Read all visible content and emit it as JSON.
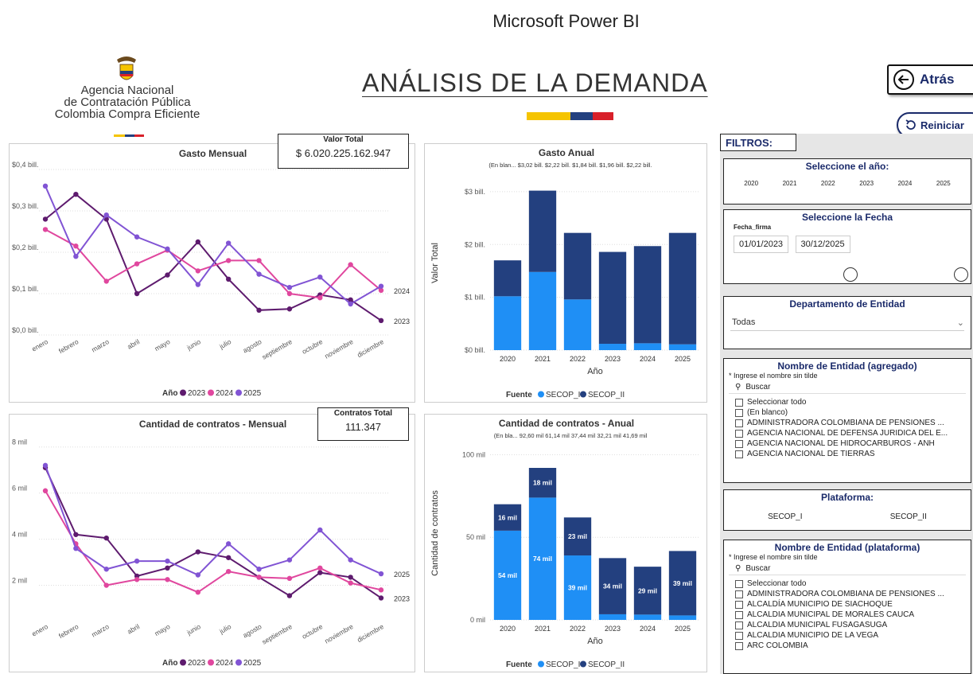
{
  "header": {
    "app_title": "Microsoft Power BI",
    "agency_line1": "Agencia Nacional",
    "agency_line2": "de Contratación Pública",
    "agency_line3": "Colombia Compra Eficiente",
    "page_title": "ANÁLISIS DE LA DEMANDA",
    "back_label": "Atrás",
    "reset_label": "Reiniciar",
    "colors": {
      "yellow": "#f5c400",
      "blue": "#23407f",
      "red": "#d8202a"
    }
  },
  "kpis": {
    "valor_label": "Valor Total",
    "valor_value": "$ 6.020.225.162.947",
    "contratos_label": "Contratos Total",
    "contratos_value": "111.347"
  },
  "chart_data": [
    {
      "id": "gasto_mensual",
      "type": "line",
      "title": "Gasto Mensual",
      "categories": [
        "enero",
        "febrero",
        "marzo",
        "abril",
        "mayo",
        "junio",
        "julio",
        "agosto",
        "septiembre",
        "octubre",
        "noviembre",
        "diciembre"
      ],
      "y_tick_labels": [
        "$0,0 bill.",
        "$0,1 bill.",
        "$0,2 bill.",
        "$0,3 bill.",
        "$0,4 bill."
      ],
      "ylim": [
        0,
        0.4
      ],
      "legend_title": "Año",
      "series": [
        {
          "name": "2023",
          "color": "#5e1b6e",
          "values": [
            0.28,
            0.34,
            0.28,
            0.1,
            0.145,
            0.225,
            0.135,
            0.06,
            0.063,
            0.097,
            0.085,
            0.035
          ]
        },
        {
          "name": "2024",
          "color": "#e0479e",
          "values": [
            0.255,
            0.215,
            0.13,
            0.172,
            0.205,
            0.155,
            0.18,
            0.18,
            0.1,
            0.09,
            0.17,
            0.108
          ]
        },
        {
          "name": "2025",
          "color": "#8154d4",
          "values": [
            0.36,
            0.19,
            0.29,
            0.237,
            0.208,
            0.122,
            0.222,
            0.147,
            0.115,
            0.14,
            0.075,
            0.118
          ]
        }
      ],
      "end_labels": [
        "2024",
        "2023"
      ]
    },
    {
      "id": "gasto_anual",
      "type": "bar",
      "stacked": true,
      "title": "Gasto Anual",
      "xlabel": "Año",
      "ylabel": "Valor Total",
      "categories": [
        "2020",
        "2021",
        "2022",
        "2023",
        "2024",
        "2025"
      ],
      "y_tick_labels": [
        "$0 bill.",
        "$1 bill.",
        "$2 bill.",
        "$3 bill."
      ],
      "ylim": [
        0,
        3.3
      ],
      "totals_label": "(En blan... $3,02 bill. $2,22 bill.  $1,84 bill. $1,96 bill. $2,22 bill.",
      "legend_title": "Fuente",
      "series": [
        {
          "name": "SECOP_I",
          "color": "#1f8ff5",
          "values": [
            1.02,
            1.48,
            0.96,
            0.12,
            0.13,
            0.11
          ]
        },
        {
          "name": "SECOP_II",
          "color": "#23407f",
          "values": [
            0.68,
            1.54,
            1.26,
            1.74,
            1.84,
            2.11
          ]
        }
      ]
    },
    {
      "id": "contratos_mensual",
      "type": "line",
      "title": "Cantidad de contratos - Mensual",
      "categories": [
        "enero",
        "febrero",
        "marzo",
        "abril",
        "mayo",
        "junio",
        "julio",
        "agosto",
        "septiembre",
        "octubre",
        "noviembre",
        "diciembre"
      ],
      "y_tick_labels": [
        "2 mil",
        "4 mil",
        "6 mil",
        "8 mil"
      ],
      "ylim": [
        0.5,
        8.3
      ],
      "legend_title": "Año",
      "series": [
        {
          "name": "2023",
          "color": "#5e1b6e",
          "values": [
            7.1,
            4.2,
            4.05,
            2.4,
            2.75,
            3.45,
            3.2,
            2.35,
            1.55,
            2.55,
            2.35,
            1.45
          ]
        },
        {
          "name": "2024",
          "color": "#e0479e",
          "values": [
            6.1,
            3.8,
            2.0,
            2.25,
            2.25,
            1.7,
            2.6,
            2.35,
            2.3,
            2.75,
            2.1,
            1.8
          ]
        },
        {
          "name": "2025",
          "color": "#8154d4",
          "values": [
            7.2,
            3.6,
            2.7,
            3.05,
            3.05,
            2.45,
            3.8,
            2.7,
            3.1,
            4.4,
            3.1,
            2.5
          ]
        }
      ],
      "end_labels": [
        "2025",
        "2023"
      ]
    },
    {
      "id": "contratos_anual",
      "type": "bar",
      "stacked": true,
      "title": "Cantidad de contratos - Anual",
      "xlabel": "Año",
      "ylabel": "Cantidad de contratos",
      "categories": [
        "2020",
        "2021",
        "2022",
        "2023",
        "2024",
        "2025"
      ],
      "y_tick_labels": [
        "0 mil",
        "50 mil",
        "100 mil"
      ],
      "ylim": [
        0,
        105
      ],
      "totals_label": "(En bla... 92,60 mil  61,14 mil  37,44 mil  32,21 mil    41,69 mil",
      "legend_title": "Fuente",
      "series": [
        {
          "name": "SECOP_I",
          "color": "#1f8ff5",
          "values": [
            54,
            74,
            39,
            3.4,
            3.2,
            2.7
          ],
          "labels": [
            "54 mil",
            "74 mil",
            "39 mil",
            "",
            "",
            ""
          ]
        },
        {
          "name": "SECOP_II",
          "color": "#23407f",
          "values": [
            16,
            18,
            23,
            34,
            29,
            39
          ],
          "labels": [
            "16 mil",
            "18 mil",
            "23 mil",
            "34 mil",
            "29 mil",
            "39 mil"
          ]
        }
      ]
    }
  ],
  "filters": {
    "label": "FILTROS:",
    "year": {
      "title": "Seleccione el año:",
      "options": [
        "2020",
        "2021",
        "2022",
        "2023",
        "2024",
        "2025"
      ]
    },
    "date": {
      "title": "Seleccione la Fecha",
      "field": "Fecha_firma",
      "start": "01/01/2023",
      "end": "30/12/2025"
    },
    "departamento": {
      "title": "Departamento de Entidad",
      "value": "Todas"
    },
    "entidad_agregado": {
      "title": "Nombre de Entidad (agregado)",
      "hint": "* Ingrese el nombre sin tilde",
      "search_placeholder": "Buscar",
      "items": [
        "Seleccionar todo",
        "(En blanco)",
        "ADMINISTRADORA COLOMBIANA DE PENSIONES ...",
        "AGENCIA NACIONAL DE DEFENSA JURIDICA DEL E...",
        "AGENCIA NACIONAL DE HIDROCARBUROS - ANH",
        "AGENCIA NACIONAL DE TIERRAS"
      ]
    },
    "plataforma": {
      "title": "Plataforma:",
      "options": [
        "SECOP_I",
        "SECOP_II"
      ]
    },
    "entidad_plataforma": {
      "title": "Nombre de Entidad (plataforma)",
      "hint": "* Ingrese el nombre sin tilde",
      "search_placeholder": "Buscar",
      "items": [
        "Seleccionar todo",
        "ADMINISTRADORA COLOMBIANA DE PENSIONES ...",
        "ALCALDÍA MUNICIPIO DE SIACHOQUE",
        "ALCALDIA MUNICIPAL DE MORALES CAUCA",
        "ALCALDIA MUNICIPAL FUSAGASUGA",
        "ALCALDIA MUNICIPIO DE LA VEGA",
        "ARC COLOMBIA"
      ]
    }
  }
}
